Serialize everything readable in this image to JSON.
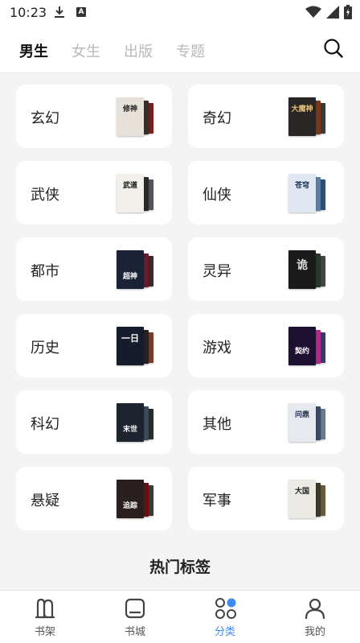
{
  "status_bar": {
    "time": "10:23",
    "a_badge": "A"
  },
  "top_tabs": [
    {
      "label": "男生",
      "active": true
    },
    {
      "label": "女生",
      "active": false
    },
    {
      "label": "出版",
      "active": false
    },
    {
      "label": "专题",
      "active": false
    }
  ],
  "categories": [
    {
      "label": "玄幻",
      "cover_title": "修神",
      "colors": [
        "#e6e2da",
        "#3a2e2a",
        "#7a1e1e"
      ]
    },
    {
      "label": "奇幻",
      "cover_title": "大魔神",
      "colors": [
        "#2a2626",
        "#7a3a1a",
        "#3a3a3a"
      ]
    },
    {
      "label": "武侠",
      "cover_title": "武道",
      "colors": [
        "#f2f0ea",
        "#2a2a2a",
        "#555555"
      ]
    },
    {
      "label": "仙侠",
      "cover_title": "苍穹",
      "colors": [
        "#dfe8f2",
        "#5c7fa6",
        "#2f4f6f"
      ]
    },
    {
      "label": "都市",
      "cover_title": "超神",
      "colors": [
        "#1a2236",
        "#6a1a2a",
        "#3a2a2a"
      ]
    },
    {
      "label": "灵异",
      "cover_title": "诡",
      "colors": [
        "#1a1a1a",
        "#2a3a2a",
        "#444444"
      ]
    },
    {
      "label": "历史",
      "cover_title": "一日",
      "colors": [
        "#151c2c",
        "#2a2020",
        "#7a3a2a"
      ]
    },
    {
      "label": "游戏",
      "cover_title": "契约",
      "colors": [
        "#1e1030",
        "#b02a8a",
        "#3a3a6a"
      ]
    },
    {
      "label": "科幻",
      "cover_title": "末世",
      "colors": [
        "#1c2430",
        "#3a4a5a",
        "#2a2a2a"
      ]
    },
    {
      "label": "其他",
      "cover_title": "问鼎",
      "colors": [
        "#e6eaf0",
        "#3a4a6a",
        "#6a7a8a"
      ]
    },
    {
      "label": "悬疑",
      "cover_title": "追踪",
      "colors": [
        "#2a1e1e",
        "#6a1010",
        "#3a3a3a"
      ]
    },
    {
      "label": "军事",
      "cover_title": "大国",
      "colors": [
        "#eceae4",
        "#3a3a2a",
        "#6a5a3a"
      ]
    }
  ],
  "section_heading": "热门标签",
  "bottom_nav": [
    {
      "label": "书架",
      "icon": "bookshelf-icon",
      "active": false
    },
    {
      "label": "书城",
      "icon": "bookstore-icon",
      "active": false
    },
    {
      "label": "分类",
      "icon": "category-icon",
      "active": true
    },
    {
      "label": "我的",
      "icon": "profile-icon",
      "active": false
    }
  ],
  "colors": {
    "accent": "#3d8bf2",
    "background": "#f4f4f4",
    "card": "#ffffff",
    "inactive_tab": "#b8b8b8"
  }
}
